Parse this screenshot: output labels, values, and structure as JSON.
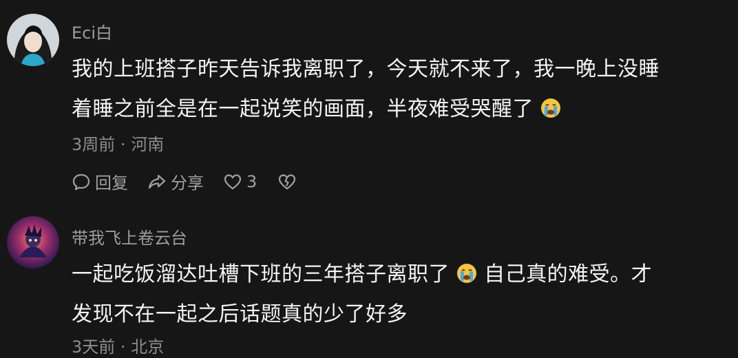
{
  "comments": [
    {
      "username": "Eci白",
      "text_line1": "我的上班搭子昨天告诉我离职了，今天就不来了，我一晚上没睡",
      "text_line2_pre": "着睡之前全是在一起说笑的画面，半夜难受哭醒了",
      "time": "3周前",
      "location": "河南",
      "reply_label": "回复",
      "share_label": "分享",
      "like_count": "3"
    },
    {
      "username": "带我飞上卷云台",
      "text_line1_pre": "一起吃饭溜达吐槽下班的三年搭子离职了",
      "text_line1_post": "自己真的难受。才",
      "text_line2": "发现不在一起之后话题真的少了好多",
      "time": "3天前",
      "location": "北京"
    }
  ],
  "separator": "·",
  "icons": {
    "emoji": "crying-face-emoji",
    "reply": "speech-bubble-icon",
    "share": "share-arrow-icon",
    "like": "heart-icon",
    "dislike": "broken-heart-icon"
  },
  "colors": {
    "background": "#161616",
    "username": "#9d9d9d",
    "text": "#f4f4f4",
    "meta": "#8e8e8e",
    "emoji": "#f5c542"
  }
}
